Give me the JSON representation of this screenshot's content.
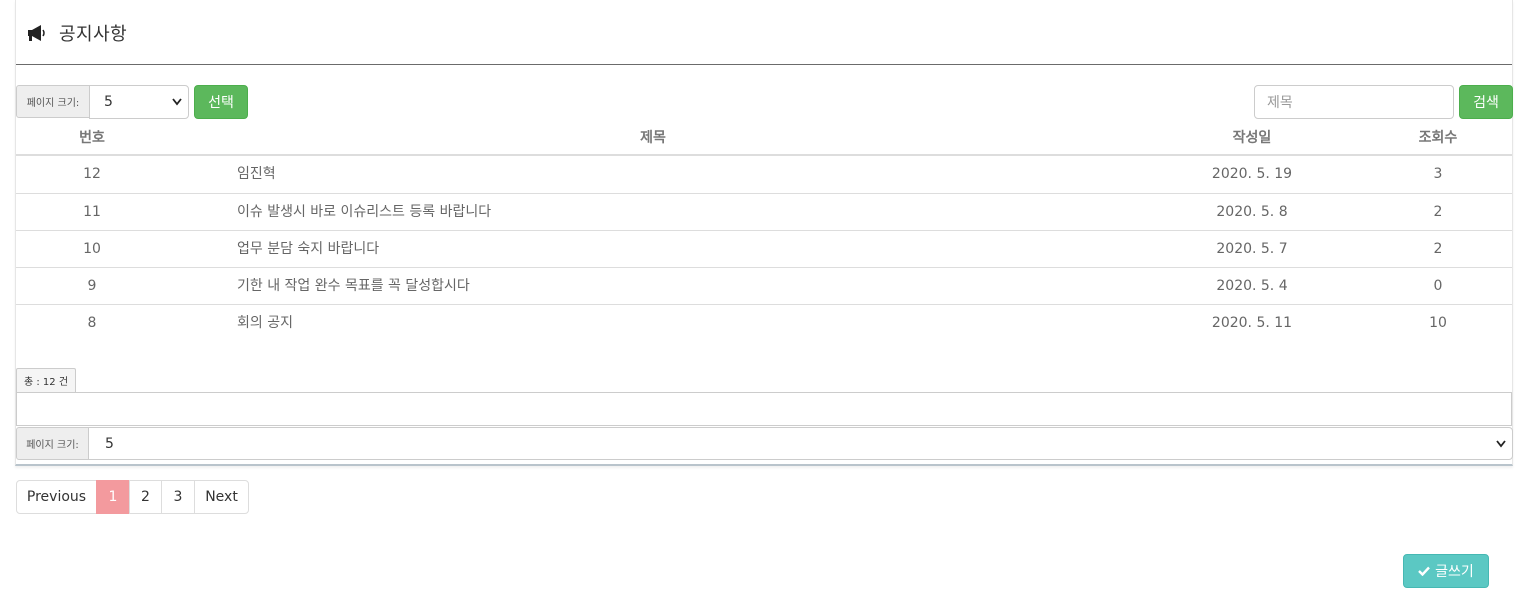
{
  "header": {
    "title": "공지사항",
    "icon": "megaphone-icon"
  },
  "toolbar": {
    "page_size_label": "페이지 크기:",
    "page_size_value": "5",
    "select_button": "선택",
    "search_placeholder": "제목",
    "search_button": "검색"
  },
  "table": {
    "columns": {
      "num": "번호",
      "title": "제목",
      "date": "작성일",
      "views": "조회수"
    },
    "rows": [
      {
        "num": "12",
        "title": "임진혁",
        "date": "2020. 5. 19",
        "views": "3"
      },
      {
        "num": "11",
        "title": "이슈 발생시 바로 이슈리스트 등록 바랍니다",
        "date": "2020. 5. 8",
        "views": "2"
      },
      {
        "num": "10",
        "title": "업무 분담 숙지 바랍니다",
        "date": "2020. 5. 7",
        "views": "2"
      },
      {
        "num": "9",
        "title": "기한 내 작업 완수 목표를 꼭 달성합시다",
        "date": "2020. 5. 4",
        "views": "0"
      },
      {
        "num": "8",
        "title": "회의 공지",
        "date": "2020. 5. 11",
        "views": "10"
      }
    ]
  },
  "footer": {
    "total_label": "총 : 12 건",
    "page_size_label": "페이지 크기:",
    "page_size_value": "5"
  },
  "pagination": {
    "previous": "Previous",
    "pages": [
      "1",
      "2",
      "3"
    ],
    "active": "1",
    "next": "Next"
  },
  "write_button": "글쓰기",
  "colors": {
    "green": "#5cb85c",
    "teal": "#5bc8c3",
    "active_page": "#f39a9e"
  }
}
